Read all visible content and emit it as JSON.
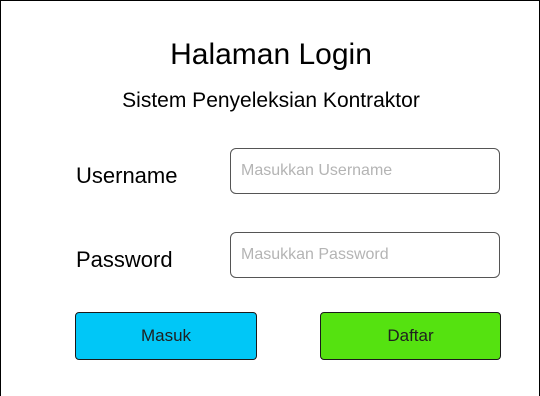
{
  "login": {
    "title": "Halaman Login",
    "subtitle": "Sistem Penyeleksian Kontraktor",
    "username": {
      "label": "Username",
      "value": "",
      "placeholder": "Masukkan Username"
    },
    "password": {
      "label": "Password",
      "value": "",
      "placeholder": "Masukkan Password"
    },
    "buttons": {
      "login_label": "Masuk",
      "register_label": "Daftar"
    }
  },
  "colors": {
    "login_button": "#00c7f7",
    "register_button": "#55e210",
    "placeholder_text": "#b4b4b4",
    "border": "#000000"
  }
}
